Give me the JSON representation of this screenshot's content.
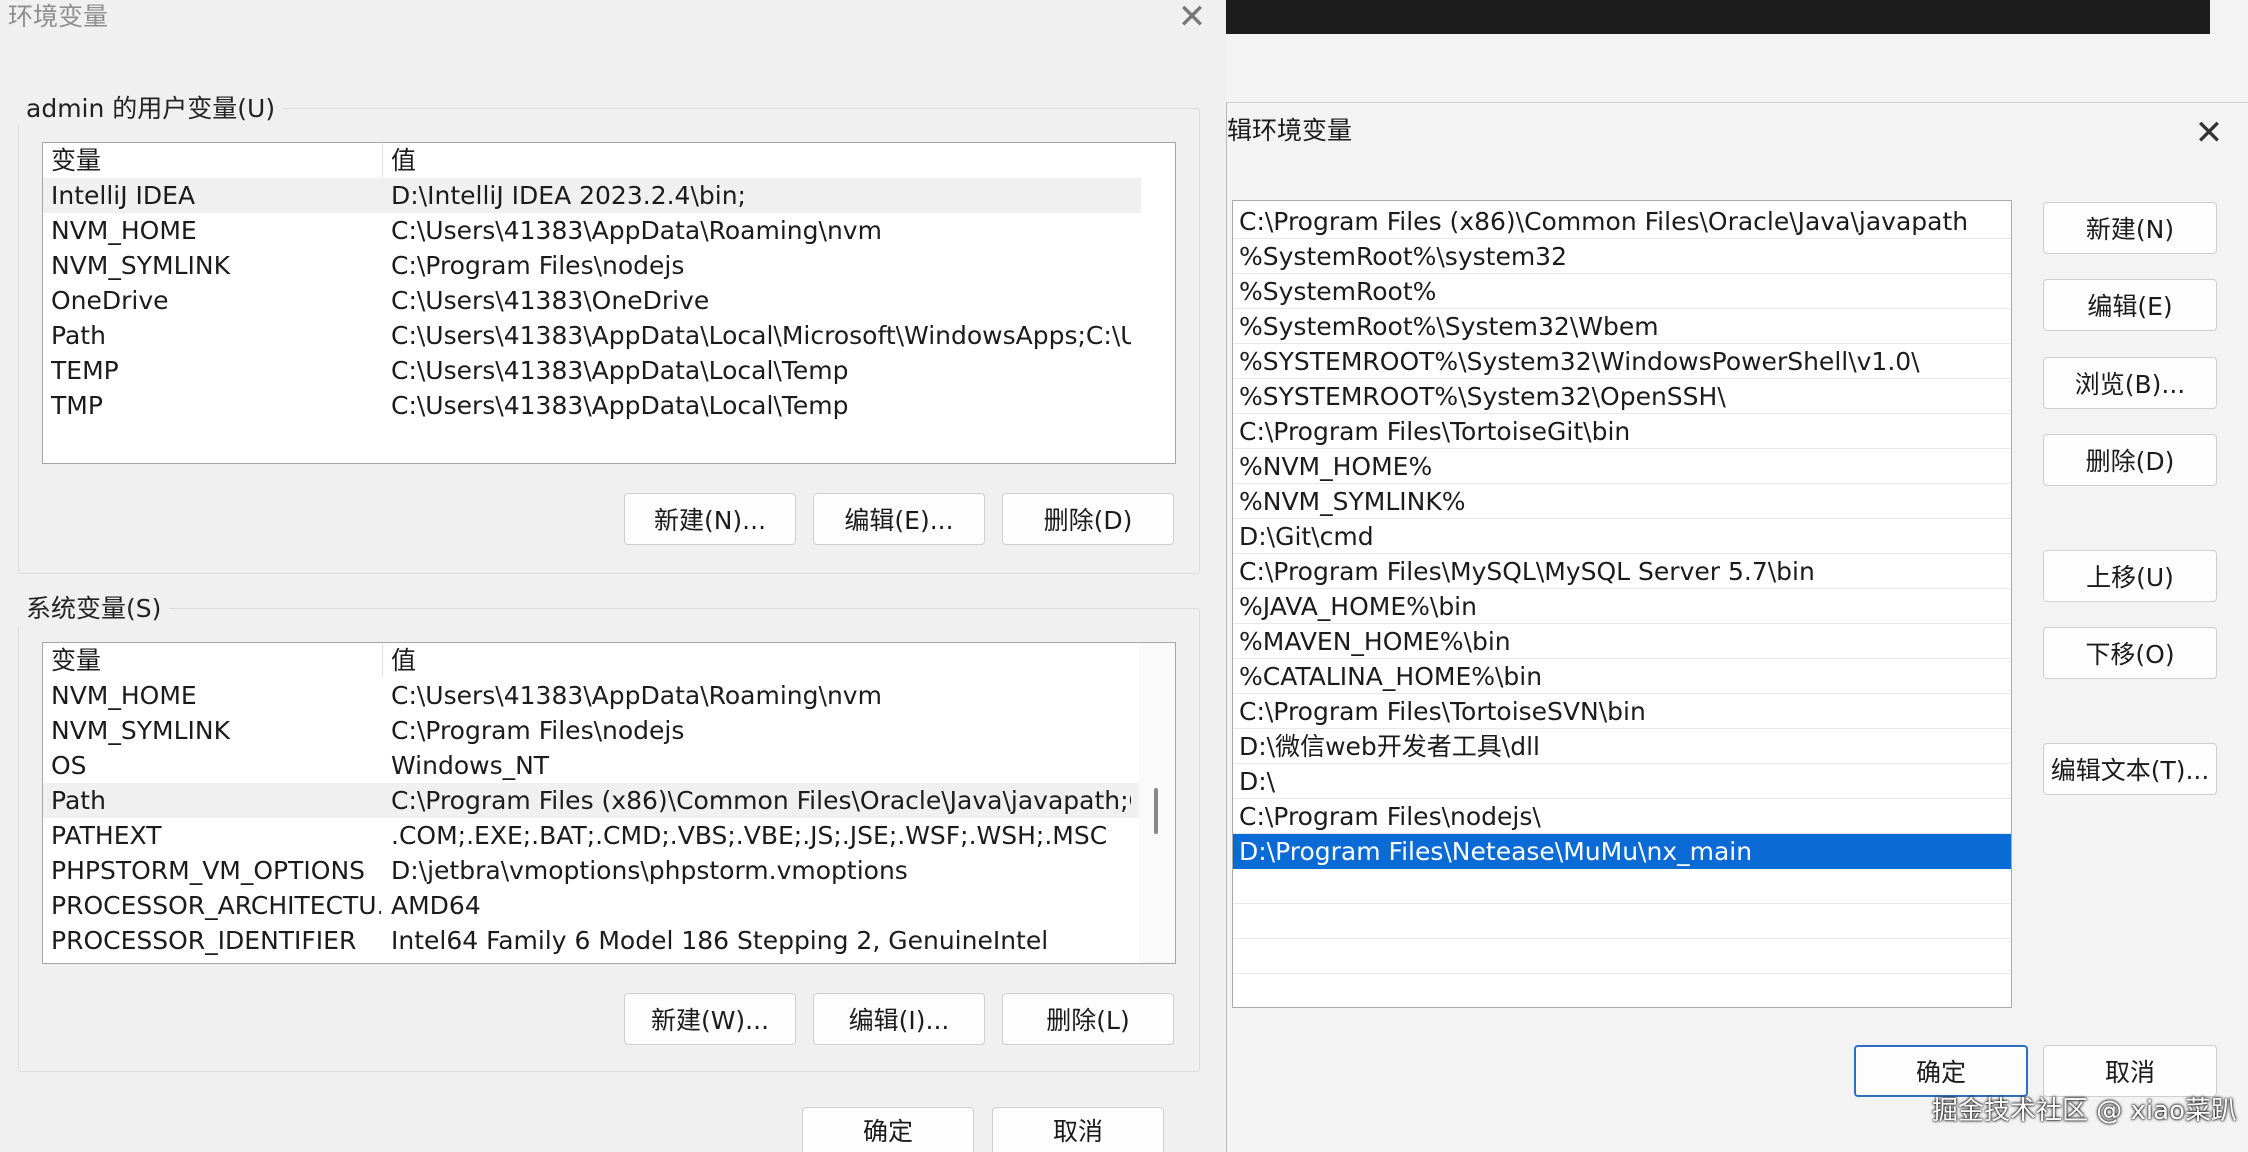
{
  "env_dialog": {
    "title": "环境变量",
    "user_group_label": "admin 的用户变量(U)",
    "user_vars": {
      "headers": [
        "变量",
        "值"
      ],
      "rows": [
        [
          "IntelliJ IDEA",
          "D:\\IntelliJ IDEA 2023.2.4\\bin;"
        ],
        [
          "NVM_HOME",
          "C:\\Users\\41383\\AppData\\Roaming\\nvm"
        ],
        [
          "NVM_SYMLINK",
          "C:\\Program Files\\nodejs"
        ],
        [
          "OneDrive",
          "C:\\Users\\41383\\OneDrive"
        ],
        [
          "Path",
          "C:\\Users\\41383\\AppData\\Local\\Microsoft\\WindowsApps;C:\\Use..."
        ],
        [
          "TEMP",
          "C:\\Users\\41383\\AppData\\Local\\Temp"
        ],
        [
          "TMP",
          "C:\\Users\\41383\\AppData\\Local\\Temp"
        ]
      ]
    },
    "user_buttons": [
      "新建(N)...",
      "编辑(E)...",
      "删除(D)"
    ],
    "system_group_label": "系统变量(S)",
    "system_vars": {
      "headers": [
        "变量",
        "值"
      ],
      "rows": [
        [
          "NVM_HOME",
          "C:\\Users\\41383\\AppData\\Roaming\\nvm"
        ],
        [
          "NVM_SYMLINK",
          "C:\\Program Files\\nodejs"
        ],
        [
          "OS",
          "Windows_NT"
        ],
        [
          "Path",
          "C:\\Program Files (x86)\\Common Files\\Oracle\\Java\\javapath;C:\\..."
        ],
        [
          "PATHEXT",
          ".COM;.EXE;.BAT;.CMD;.VBS;.VBE;.JS;.JSE;.WSF;.WSH;.MSC"
        ],
        [
          "PHPSTORM_VM_OPTIONS",
          "D:\\jetbra\\vmoptions\\phpstorm.vmoptions"
        ],
        [
          "PROCESSOR_ARCHITECTU...",
          "AMD64"
        ],
        [
          "PROCESSOR_IDENTIFIER",
          "Intel64 Family 6 Model 186 Stepping 2, GenuineIntel"
        ]
      ]
    },
    "system_buttons": [
      "新建(W)...",
      "编辑(I)...",
      "删除(L)"
    ],
    "ok_label": "确定",
    "cancel_label": "取消"
  },
  "edit_dialog": {
    "title": "辑环境变量",
    "paths": [
      "C:\\Program Files (x86)\\Common Files\\Oracle\\Java\\javapath",
      "%SystemRoot%\\system32",
      "%SystemRoot%",
      "%SystemRoot%\\System32\\Wbem",
      "%SYSTEMROOT%\\System32\\WindowsPowerShell\\v1.0\\",
      "%SYSTEMROOT%\\System32\\OpenSSH\\",
      "C:\\Program Files\\TortoiseGit\\bin",
      "%NVM_HOME%",
      "%NVM_SYMLINK%",
      "D:\\Git\\cmd",
      "C:\\Program Files\\MySQL\\MySQL Server 5.7\\bin",
      "%JAVA_HOME%\\bin",
      "%MAVEN_HOME%\\bin",
      "%CATALINA_HOME%\\bin",
      "C:\\Program Files\\TortoiseSVN\\bin",
      "D:\\微信web开发者工具\\dll",
      "D:\\",
      "C:\\Program Files\\nodejs\\",
      "D:\\Program Files\\Netease\\MuMu\\nx_main",
      "",
      "",
      ""
    ],
    "selected_index": 18,
    "buttons": {
      "new": "新建(N)",
      "edit": "编辑(E)",
      "browse": "浏览(B)...",
      "delete": "删除(D)",
      "move_up": "上移(U)",
      "move_down": "下移(O)",
      "edit_text": "编辑文本(T)..."
    },
    "ok_label": "确定",
    "cancel_label": "取消"
  },
  "watermark": "掘金技术社区 @ xiao菜趴",
  "colors": {
    "selection": "#0a6ad6",
    "primary_border": "#2f6fbf"
  }
}
